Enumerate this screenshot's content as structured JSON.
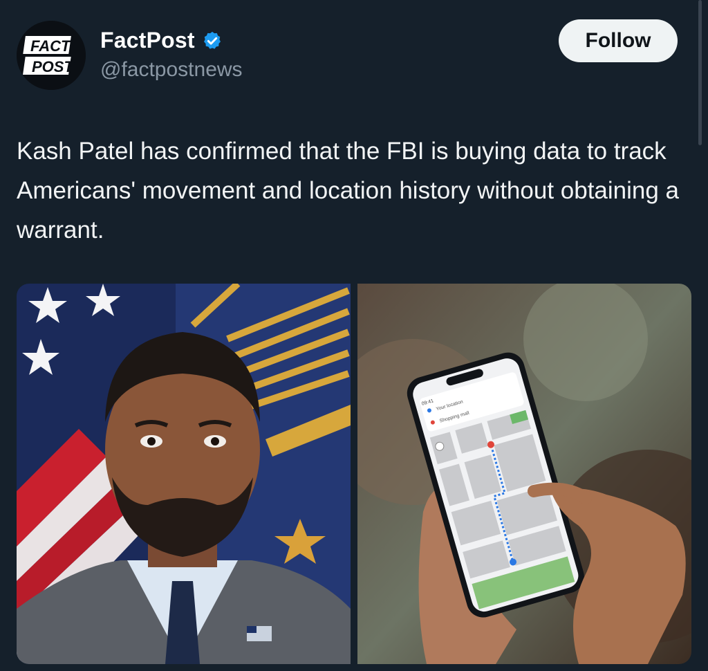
{
  "post": {
    "author": {
      "display_name": "FactPost",
      "handle": "@factpostnews",
      "verified": true,
      "avatar_text_top": "FACT",
      "avatar_text_bottom": "POST"
    },
    "follow_label": "Follow",
    "text": "Kash Patel has confirmed that the FBI is buying data to track Americans' movement and location history without obtaining a warrant.",
    "media": [
      {
        "kind": "photo",
        "description_icon": "portrait-photo-icon"
      },
      {
        "kind": "photo",
        "description_icon": "phone-map-photo-icon",
        "phone": {
          "time": "09:41",
          "your_location": "Your location",
          "destination": "Shopping mall"
        }
      }
    ]
  },
  "colors": {
    "background": "#15202b",
    "verified_badge": "#1d9bf0",
    "follow_button_bg": "#eff3f4",
    "handle_text": "#8b98a5"
  }
}
